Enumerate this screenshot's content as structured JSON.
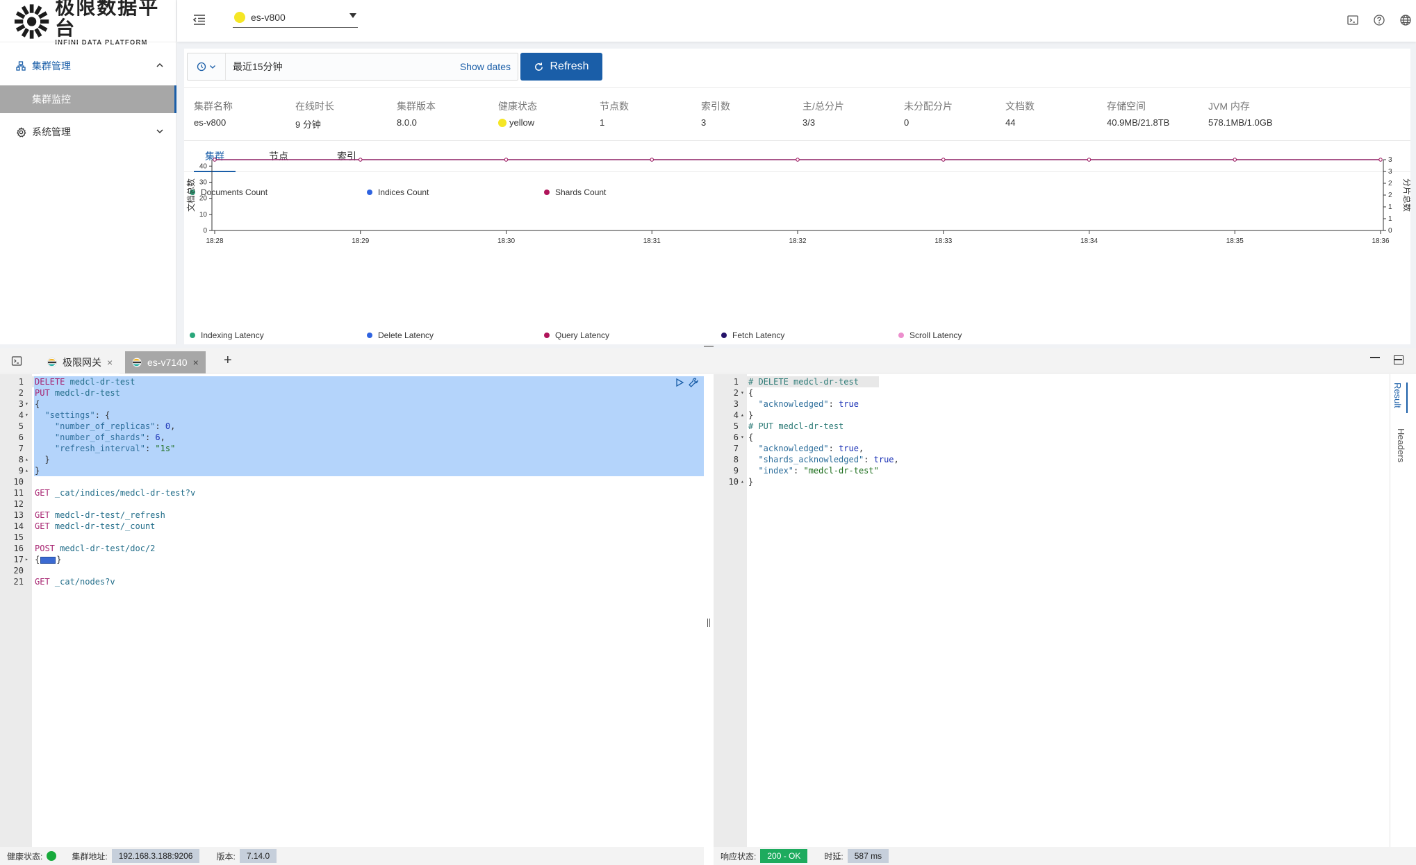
{
  "app": {
    "logo_cn": "极限数据平台",
    "logo_en": "INFINI DATA PLATFORM"
  },
  "sidebar": {
    "items": [
      {
        "label": "集群管理",
        "icon": "cluster-icon",
        "expanded": true
      },
      {
        "label": "集群监控",
        "selected": true
      },
      {
        "label": "系统管理",
        "icon": "gear-icon",
        "expanded": false
      }
    ]
  },
  "header": {
    "cluster_name": "es-v800",
    "cluster_status_color": "#f5e625"
  },
  "toolbar": {
    "time_range": "最近15分钟",
    "show_dates": "Show dates",
    "refresh": "Refresh"
  },
  "stats": [
    {
      "label": "集群名称",
      "value": "es-v800"
    },
    {
      "label": "在线时长",
      "value": "9 分钟"
    },
    {
      "label": "集群版本",
      "value": "8.0.0"
    },
    {
      "label": "健康状态",
      "value": "yellow"
    },
    {
      "label": "节点数",
      "value": "1"
    },
    {
      "label": "索引数",
      "value": "3"
    },
    {
      "label": "主/总分片",
      "value": "3/3"
    },
    {
      "label": "未分配分片",
      "value": "0"
    },
    {
      "label": "文档数",
      "value": "44"
    },
    {
      "label": "存储空间",
      "value": "40.9MB/21.8TB"
    },
    {
      "label": "JVM 内存",
      "value": "578.1MB/1.0GB"
    }
  ],
  "tabs": [
    {
      "label": "集群",
      "active": true
    },
    {
      "label": "节点",
      "active": false
    },
    {
      "label": "索引",
      "active": false
    }
  ],
  "chart_data": {
    "type": "line",
    "x": [
      "18:28",
      "18:29",
      "18:30",
      "18:31",
      "18:32",
      "18:33",
      "18:34",
      "18:35",
      "18:36"
    ],
    "ylabel": "文档总数",
    "y2label": "分片总数",
    "ylim": [
      0,
      40
    ],
    "yticks": [
      0,
      10,
      20,
      30,
      40
    ],
    "y2ticks": [
      "0",
      "1",
      "1",
      "2",
      "2",
      "3",
      "3"
    ],
    "legend": "top-left",
    "series": [
      {
        "name": "Documents Count",
        "color": "#2aa77b",
        "axis": "left",
        "values": [
          44,
          44,
          44,
          44,
          44,
          44,
          44,
          44,
          44
        ]
      },
      {
        "name": "Indices Count",
        "color": "#2f63e0",
        "axis": "right",
        "values": [
          3,
          3,
          3,
          3,
          3,
          3,
          3,
          3,
          3
        ]
      },
      {
        "name": "Shards Count",
        "color": "#b0145a",
        "axis": "right",
        "values": [
          3,
          3,
          3,
          3,
          3,
          3,
          3,
          3,
          3
        ]
      }
    ]
  },
  "latency_legend": [
    {
      "name": "Indexing Latency",
      "color": "#2aa77b"
    },
    {
      "name": "Delete Latency",
      "color": "#2f63e0"
    },
    {
      "name": "Query Latency",
      "color": "#b0145a"
    },
    {
      "name": "Fetch Latency",
      "color": "#251369"
    },
    {
      "name": "Scroll Latency",
      "color": "#ec8fcd"
    }
  ],
  "console": {
    "tabs": [
      {
        "label": "极限网关",
        "active": false
      },
      {
        "label": "es-v7140",
        "active": true
      }
    ],
    "editor_lines": [
      [
        {
          "t": "DELETE",
          "c": "kw"
        },
        {
          "t": " medcl-dr-test",
          "c": "url"
        }
      ],
      [
        {
          "t": "PUT",
          "c": "kw"
        },
        {
          "t": " medcl-dr-test",
          "c": "url"
        }
      ],
      [
        {
          "t": "{",
          "c": ""
        }
      ],
      [
        {
          "t": "  ",
          "c": ""
        },
        {
          "t": "\"settings\"",
          "c": "key"
        },
        {
          "t": ": {",
          "c": ""
        }
      ],
      [
        {
          "t": "    ",
          "c": ""
        },
        {
          "t": "\"number_of_replicas\"",
          "c": "key"
        },
        {
          "t": ": ",
          "c": ""
        },
        {
          "t": "0",
          "c": "num"
        },
        {
          "t": ",",
          "c": ""
        }
      ],
      [
        {
          "t": "    ",
          "c": ""
        },
        {
          "t": "\"number_of_shards\"",
          "c": "key"
        },
        {
          "t": ": ",
          "c": ""
        },
        {
          "t": "6",
          "c": "num"
        },
        {
          "t": ",",
          "c": ""
        }
      ],
      [
        {
          "t": "    ",
          "c": ""
        },
        {
          "t": "\"refresh_interval\"",
          "c": "key"
        },
        {
          "t": ": ",
          "c": ""
        },
        {
          "t": "\"1s\"",
          "c": "str"
        }
      ],
      [
        {
          "t": "  }",
          "c": ""
        }
      ],
      [
        {
          "t": "}",
          "c": ""
        }
      ],
      [
        {
          "t": "",
          "c": ""
        }
      ],
      [
        {
          "t": "GET",
          "c": "kw"
        },
        {
          "t": " _cat/indices/medcl-dr-test?v",
          "c": "url"
        }
      ],
      [
        {
          "t": "",
          "c": ""
        }
      ],
      [
        {
          "t": "GET",
          "c": "kw"
        },
        {
          "t": " medcl-dr-test/_refresh",
          "c": "url"
        }
      ],
      [
        {
          "t": "GET",
          "c": "kw"
        },
        {
          "t": " medcl-dr-test/_count",
          "c": "url"
        }
      ],
      [
        {
          "t": "",
          "c": ""
        }
      ],
      [
        {
          "t": "POST",
          "c": "kw"
        },
        {
          "t": " medcl-dr-test/doc/2",
          "c": "url"
        }
      ],
      [
        {
          "t": "{",
          "c": ""
        },
        {
          "t": "",
          "c": "ellipsis"
        },
        {
          "t": "}",
          "c": ""
        }
      ],
      [
        {
          "t": "",
          "c": ""
        }
      ],
      [
        {
          "t": "",
          "c": ""
        }
      ],
      [
        {
          "t": "",
          "c": ""
        }
      ],
      [
        {
          "t": "GET",
          "c": "kw"
        },
        {
          "t": " _cat/nodes?v",
          "c": "url"
        }
      ]
    ],
    "editor_line_numbers": [
      "1",
      "2",
      "3",
      "4",
      "5",
      "6",
      "7",
      "8",
      "9",
      "10",
      "11",
      "12",
      "13",
      "14",
      "15",
      "16",
      "17",
      "20",
      "21"
    ],
    "editor_folds": {
      "3": "▾",
      "4": "▾",
      "8": "▴",
      "9": "▴",
      "17": "▸"
    },
    "result_lines": [
      [
        {
          "t": "# DELETE medcl-dr-test",
          "c": "cmt"
        }
      ],
      [
        {
          "t": "{",
          "c": ""
        }
      ],
      [
        {
          "t": "  ",
          "c": ""
        },
        {
          "t": "\"acknowledged\"",
          "c": "key"
        },
        {
          "t": ": ",
          "c": ""
        },
        {
          "t": "true",
          "c": "bool"
        }
      ],
      [
        {
          "t": "}",
          "c": ""
        }
      ],
      [
        {
          "t": "# PUT medcl-dr-test",
          "c": "cmt"
        }
      ],
      [
        {
          "t": "{",
          "c": ""
        }
      ],
      [
        {
          "t": "  ",
          "c": ""
        },
        {
          "t": "\"acknowledged\"",
          "c": "key"
        },
        {
          "t": ": ",
          "c": ""
        },
        {
          "t": "true",
          "c": "bool"
        },
        {
          "t": ",",
          "c": ""
        }
      ],
      [
        {
          "t": "  ",
          "c": ""
        },
        {
          "t": "\"shards_acknowledged\"",
          "c": "key"
        },
        {
          "t": ": ",
          "c": ""
        },
        {
          "t": "true",
          "c": "bool"
        },
        {
          "t": ",",
          "c": ""
        }
      ],
      [
        {
          "t": "  ",
          "c": ""
        },
        {
          "t": "\"index\"",
          "c": "key"
        },
        {
          "t": ": ",
          "c": ""
        },
        {
          "t": "\"medcl-dr-test\"",
          "c": "str"
        }
      ],
      [
        {
          "t": "}",
          "c": ""
        }
      ]
    ],
    "result_folds": {
      "2": "▾",
      "4": "▴",
      "6": "▾",
      "10": "▴"
    },
    "result_tabs": [
      "Result",
      "Headers"
    ]
  },
  "status_left": {
    "health_label": "健康状态:",
    "health_color": "#17a93b",
    "address_label": "集群地址:",
    "address": "192.168.3.188:9206",
    "version_label": "版本:",
    "version": "7.14.0"
  },
  "status_right": {
    "response_label": "响应状态:",
    "response": "200 - OK",
    "latency_label": "时延:",
    "latency": "587 ms"
  }
}
